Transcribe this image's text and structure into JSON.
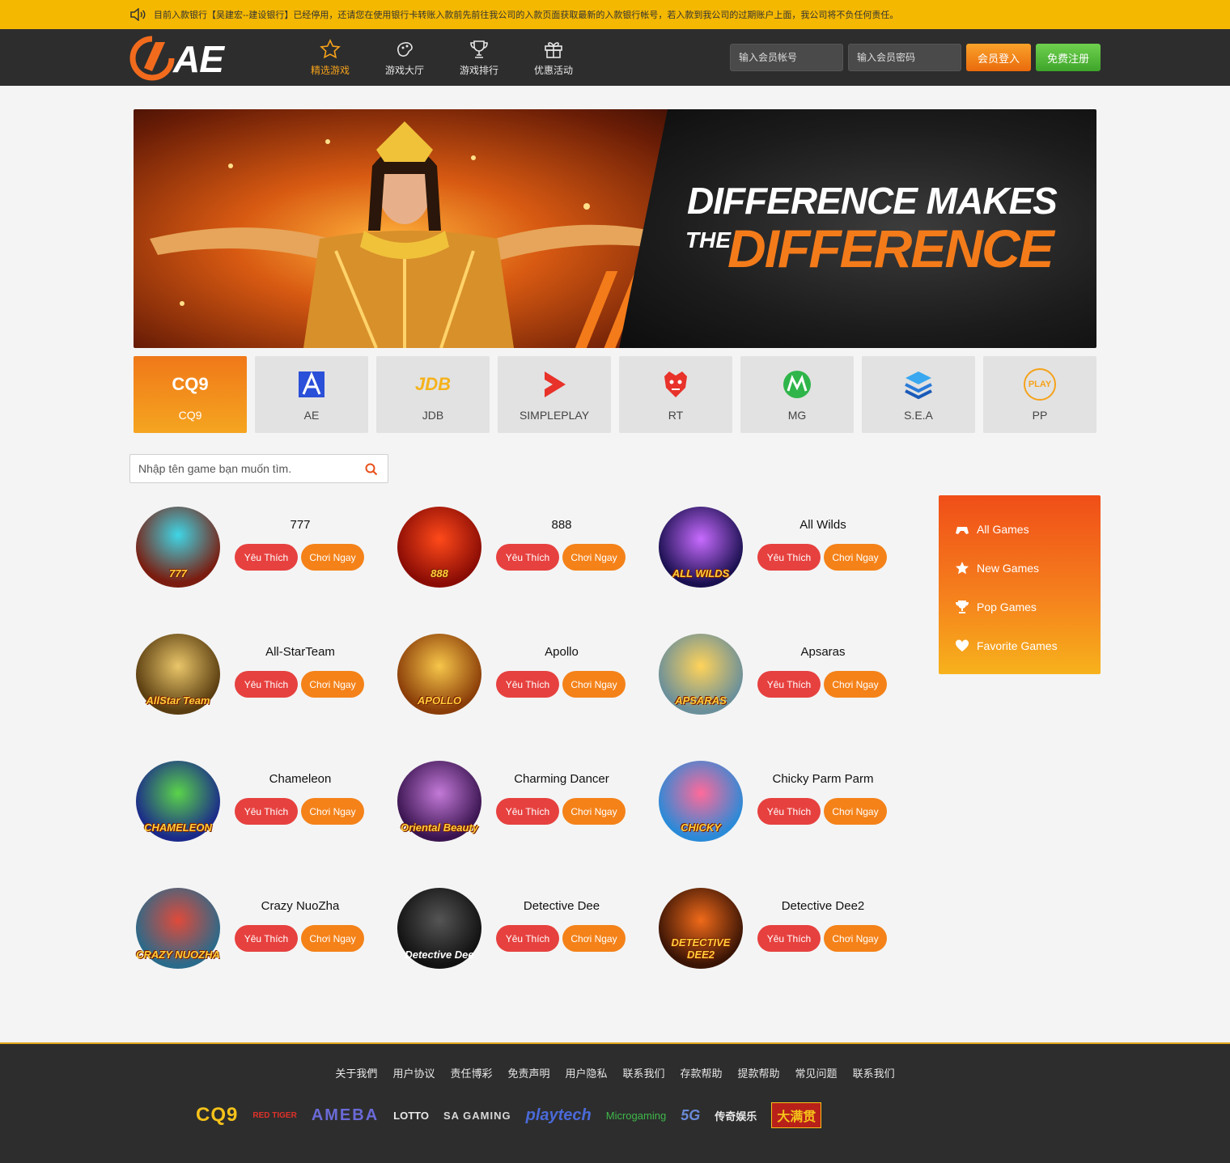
{
  "notice": {
    "text": "目前入款银行【吴建宏--建设银行】已经停用，还请您在使用银行卡转账入款前先前往我公司的入款页面获取最新的入款银行帐号，若入款到我公司的过期账户上面，我公司将不负任何责任。"
  },
  "header": {
    "logo_text": "AE",
    "nav": [
      {
        "label": "精选游戏",
        "icon": "star-icon",
        "active": true
      },
      {
        "label": "游戏大厅",
        "icon": "gamepad-icon",
        "active": false
      },
      {
        "label": "游戏排行",
        "icon": "trophy-icon",
        "active": false
      },
      {
        "label": "优惠活动",
        "icon": "gift-icon",
        "active": false
      }
    ],
    "account_placeholder": "输入会员帐号",
    "password_placeholder": "输入会员密码",
    "login_label": "会员登入",
    "register_label": "免费注册"
  },
  "banner": {
    "line1": "DIFFERENCE MAKES",
    "line2_prefix": "THE",
    "line2_main": "DIFFERENCE"
  },
  "providers": [
    {
      "label": "CQ9",
      "active": true
    },
    {
      "label": "AE",
      "active": false
    },
    {
      "label": "JDB",
      "active": false
    },
    {
      "label": "SIMPLEPLAY",
      "active": false
    },
    {
      "label": "RT",
      "active": false
    },
    {
      "label": "MG",
      "active": false
    },
    {
      "label": "S.E.A",
      "active": false
    },
    {
      "label": "PP",
      "active": false
    }
  ],
  "provider_logos": {
    "cq9": "CQ9",
    "jdb": "JDB",
    "pp": "PLAY"
  },
  "search": {
    "placeholder": "Nhập tên game bạn muốn tìm."
  },
  "game_buttons": {
    "like": "Yêu Thích",
    "play": "Chơi Ngay"
  },
  "games": [
    {
      "title": "777",
      "thumb_text": "777",
      "colors": [
        "#3fd6e6",
        "#7a1d10"
      ]
    },
    {
      "title": "888",
      "thumb_text": "888",
      "colors": [
        "#ff4a1a",
        "#8a0c05"
      ]
    },
    {
      "title": "All Wilds",
      "thumb_text": "ALL WILDS",
      "colors": [
        "#c86bff",
        "#1a1050"
      ]
    },
    {
      "title": "All-StarTeam",
      "thumb_text": "AllStar Team",
      "colors": [
        "#e9c66a",
        "#5a3d10"
      ]
    },
    {
      "title": "Apollo",
      "thumb_text": "APOLLO",
      "colors": [
        "#f7c64a",
        "#8a3d08"
      ]
    },
    {
      "title": "Apsaras",
      "thumb_text": "APSARAS",
      "colors": [
        "#ffd35a",
        "#6a8f9a"
      ]
    },
    {
      "title": "Chameleon",
      "thumb_text": "CHAMELEON",
      "colors": [
        "#5ad34a",
        "#1a2a8a"
      ]
    },
    {
      "title": "Charming Dancer",
      "thumb_text": "Oriental Beauty",
      "colors": [
        "#c37ad8",
        "#3a1450"
      ]
    },
    {
      "title": "Chicky Parm Parm",
      "thumb_text": "CHICKY",
      "colors": [
        "#ff6a9a",
        "#2a8ad8"
      ]
    },
    {
      "title": "Crazy NuoZha",
      "thumb_text": "CRAZY NUOZHA",
      "colors": [
        "#e04a3a",
        "#2a6a8a"
      ]
    },
    {
      "title": "Detective Dee",
      "thumb_text": "Detective Dee",
      "colors": [
        "#555555",
        "#111111"
      ]
    },
    {
      "title": "Detective Dee2",
      "thumb_text": "DETECTIVE DEE2",
      "colors": [
        "#f06a1a",
        "#3a1405"
      ]
    }
  ],
  "categories": [
    {
      "label": "All Games",
      "icon": "gamepad-icon"
    },
    {
      "label": "New Games",
      "icon": "star-icon"
    },
    {
      "label": "Pop Games",
      "icon": "trophy-icon"
    },
    {
      "label": "Favorite Games",
      "icon": "heart-icon"
    }
  ],
  "footer": {
    "links": [
      "关于我們",
      "用户协议",
      "责任博彩",
      "免责声明",
      "用户隐私",
      "联系我们",
      "存款帮助",
      "提款帮助",
      "常见问题",
      "联系我们"
    ],
    "logos": [
      {
        "text": "CQ9",
        "color": "#f5c21a"
      },
      {
        "text": "RED TIGER",
        "color": "#e0312a"
      },
      {
        "text": "AMEBA",
        "color": "#6a6ad8"
      },
      {
        "text": "LOTTO",
        "color": "#e0312a"
      },
      {
        "text": "SA GAMING",
        "color": "#d8d8d8"
      },
      {
        "text": "playtech",
        "color": "#4a6ad8"
      },
      {
        "text": "Microgaming",
        "color": "#3fb84a"
      },
      {
        "text": "5G",
        "color": "#6a8ad8"
      },
      {
        "text": "传奇娱乐",
        "color": "#e8e8e8"
      },
      {
        "text": "大满贯",
        "color": "#f5c21a"
      }
    ]
  },
  "colors": {
    "accent": "#f48219",
    "notice_bg": "#f5b800",
    "header_bg": "#2d2d2d",
    "like_red": "#e6413f",
    "register_green": "#4cb536"
  }
}
